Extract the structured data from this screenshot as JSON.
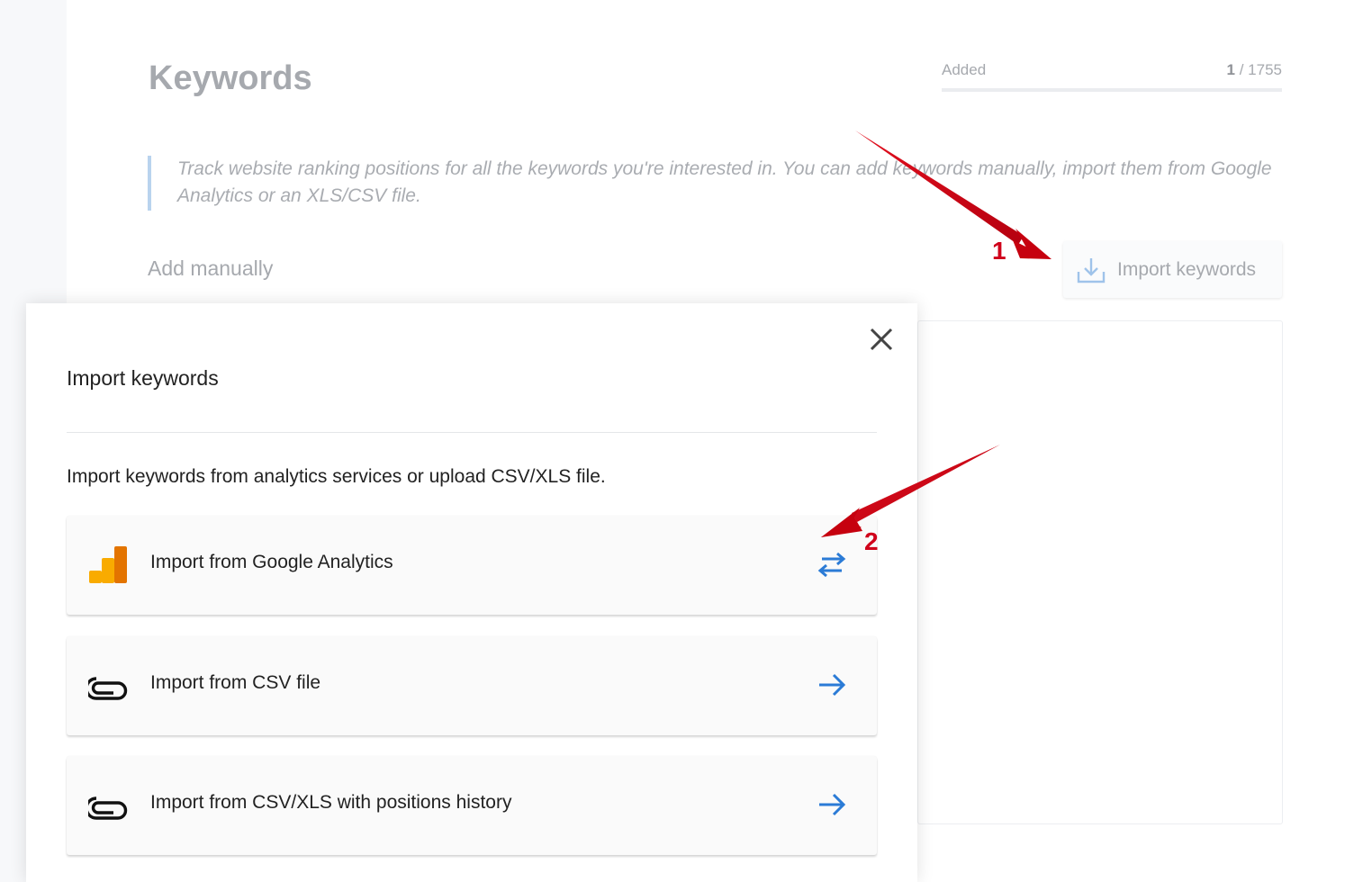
{
  "page": {
    "title": "Keywords",
    "counter": {
      "label": "Added",
      "current": "1",
      "separator": " / ",
      "total": "1755"
    },
    "hint": "Track website ranking positions for all the keywords you're interested in. You can add keywords manually, import them from Google Analytics or an XLS/CSV file.",
    "add_manually_label": "Add manually",
    "import_button_label": "Import keywords"
  },
  "modal": {
    "title": "Import keywords",
    "description": "Import keywords from analytics services or upload CSV/XLS file.",
    "close_icon": "close-icon",
    "options": [
      {
        "label": "Import from Google Analytics",
        "icon": "google-analytics-icon",
        "action_icon": "swap-arrows-icon"
      },
      {
        "label": "Import from CSV file",
        "icon": "paperclip-icon",
        "action_icon": "arrow-right-icon"
      },
      {
        "label": "Import from CSV/XLS with positions history",
        "icon": "paperclip-icon",
        "action_icon": "arrow-right-icon"
      }
    ]
  },
  "annotations": {
    "step1": "1",
    "step2": "2"
  },
  "colors": {
    "accent_blue": "#2b7bd6",
    "annotation_red": "#d0021b",
    "ga_yellow": "#f9ab00",
    "ga_orange": "#e37400"
  }
}
